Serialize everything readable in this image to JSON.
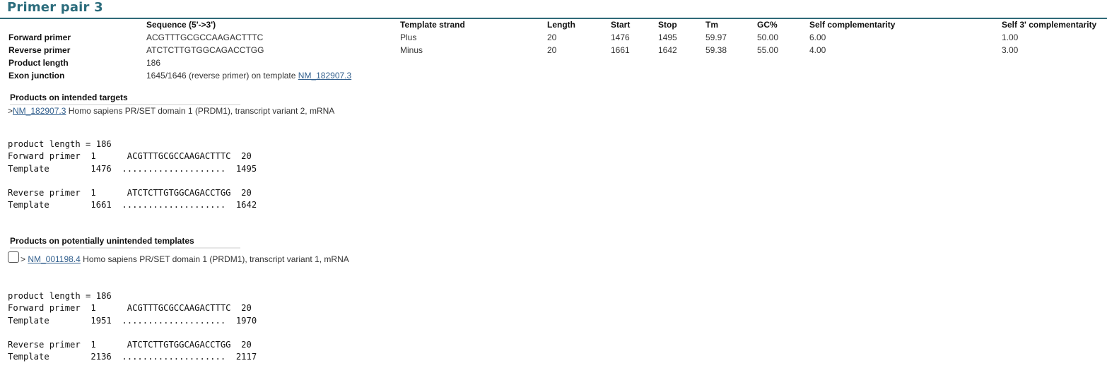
{
  "title": "Primer pair 3",
  "table": {
    "headers": {
      "sequence": "Sequence (5'->3')",
      "strand": "Template strand",
      "length": "Length",
      "start": "Start",
      "stop": "Stop",
      "tm": "Tm",
      "gc": "GC%",
      "self_comp": "Self complementarity",
      "self3": "Self 3' complementarity"
    },
    "rows": [
      {
        "label": "Forward primer",
        "sequence": "ACGTTTGCGCCAAGACTTTC",
        "strand": "Plus",
        "length": "20",
        "start": "1476",
        "stop": "1495",
        "tm": "59.97",
        "gc": "50.00",
        "self_comp": "6.00",
        "self3": "1.00"
      },
      {
        "label": "Reverse primer",
        "sequence": "ATCTCTTGTGGCAGACCTGG",
        "strand": "Minus",
        "length": "20",
        "start": "1661",
        "stop": "1642",
        "tm": "59.38",
        "gc": "55.00",
        "self_comp": "4.00",
        "self3": "3.00"
      }
    ],
    "product_length": {
      "label": "Product length",
      "value": "186"
    },
    "exon_junction": {
      "label": "Exon junction",
      "text": "1645/1646 (reverse primer) on template ",
      "link": "NM_182907.3"
    }
  },
  "intended": {
    "heading": "Products on intended targets",
    "prefix": ">",
    "accession": "NM_182907.3",
    "description": " Homo sapiens PR/SET domain 1 (PRDM1), transcript variant 2, mRNA",
    "alignment": "product length = 186\nForward primer  1      ACGTTTGCGCCAAGACTTTC  20\nTemplate        1476  ....................  1495\n\nReverse primer  1      ATCTCTTGTGGCAGACCTGG  20\nTemplate        1661  ....................  1642"
  },
  "unintended": {
    "heading": "Products on potentially unintended templates",
    "prefix": "> ",
    "accession": "NM_001198.4",
    "description": " Homo sapiens PR/SET domain 1 (PRDM1), transcript variant 1, mRNA",
    "alignment": "product length = 186\nForward primer  1      ACGTTTGCGCCAAGACTTTC  20\nTemplate        1951  ....................  1970\n\nReverse primer  1      ATCTCTTGTGGCAGACCTGG  20\nTemplate        2136  ....................  2117"
  }
}
